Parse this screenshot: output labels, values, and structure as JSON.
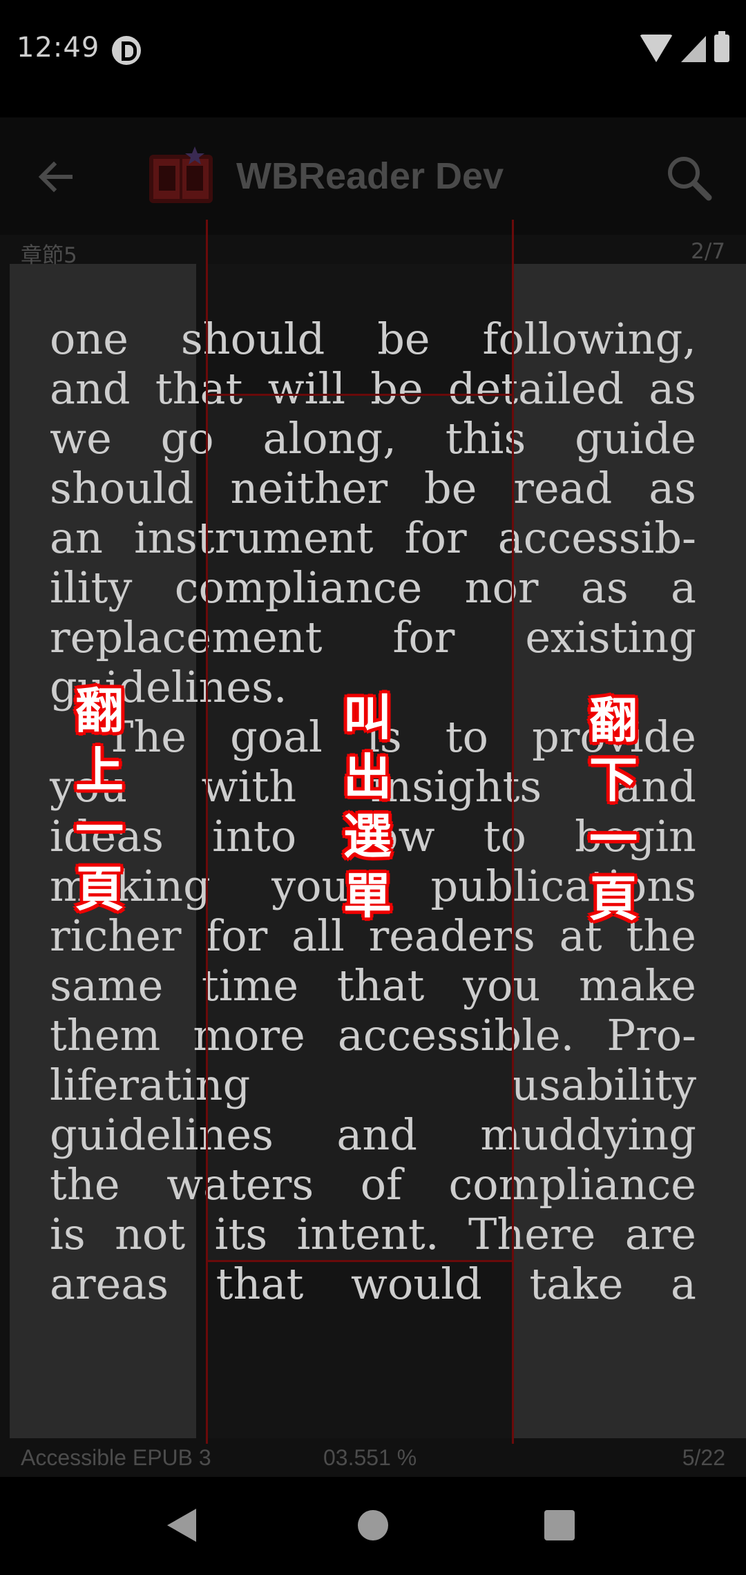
{
  "status_bar": {
    "time": "12:49"
  },
  "toolbar": {
    "title": "WBReader Dev",
    "back_icon": "arrow-left-icon",
    "search_icon": "search-icon"
  },
  "header": {
    "chapter": "章節5",
    "chapter_page": "2/7"
  },
  "content": {
    "lines": [
      "one should be following,",
      "and that will be detailed as",
      "we go along, this guide",
      "should neither be read as",
      "an instrument for accessib-",
      "ility compliance nor as a",
      "replacement for existing",
      "guidelines.",
      "The goal is to provide",
      "you with insights and",
      "ideas into how to begin",
      "making your publications",
      "richer for all readers at the",
      "same time that you make",
      "them more accessible. Pro-",
      "liferating usability",
      "guidelines and muddying",
      "the waters of compliance",
      "is not its intent. There are",
      "areas that would take a"
    ]
  },
  "tap_zones": {
    "prev": "翻上一頁",
    "menu": "叫出選單",
    "next": "翻下一頁"
  },
  "footer": {
    "book_title": "Accessible EPUB 3",
    "progress": "03.551 %",
    "book_page": "5/22"
  },
  "colors": {
    "overlay_red": "#e00000",
    "text": "#cdcdcd"
  }
}
